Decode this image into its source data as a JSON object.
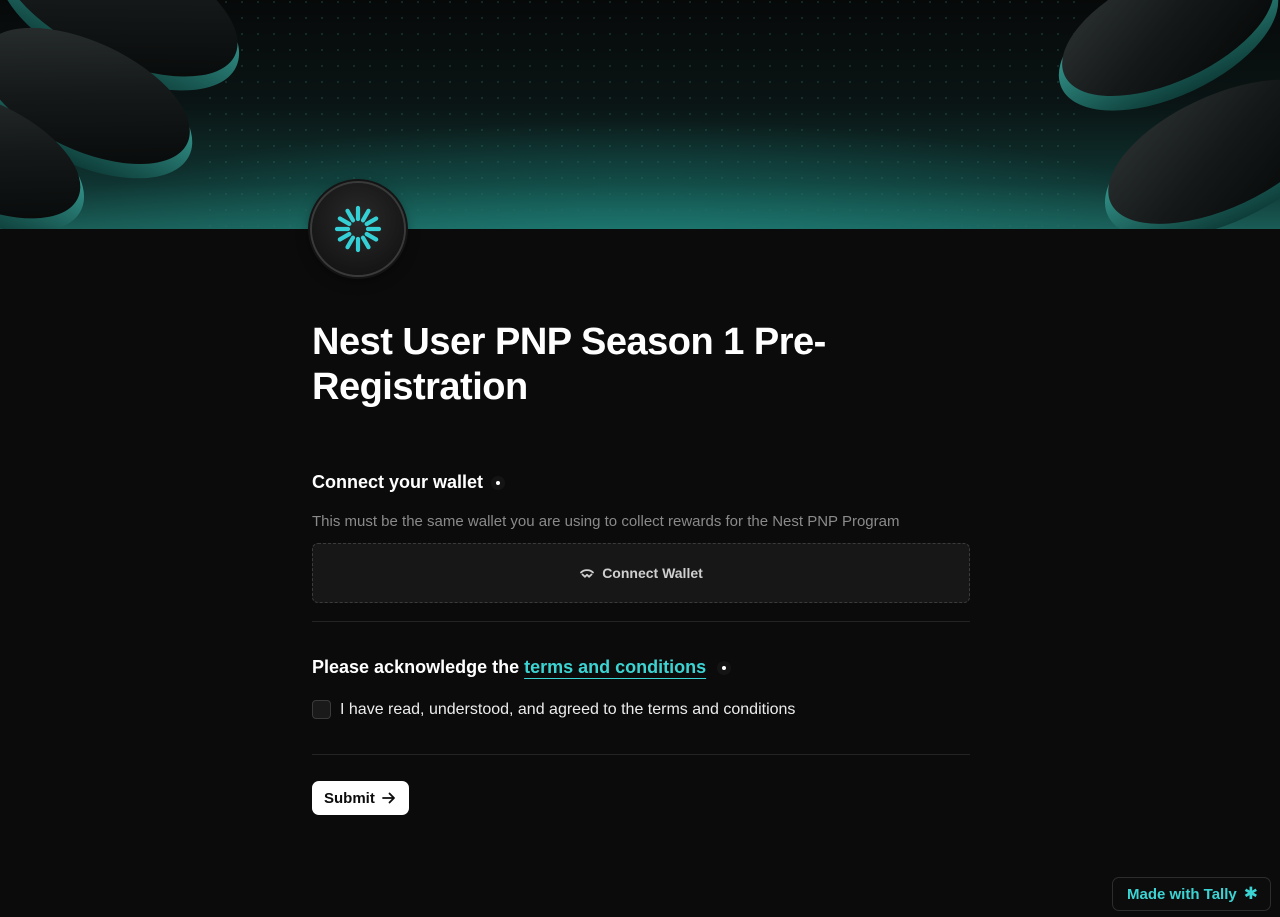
{
  "colors": {
    "background": "#0b0b0b",
    "accent": "#3cd3d3",
    "text": "#ffffff",
    "muted": "#8a8a8a"
  },
  "form": {
    "title": "Nest User PNP Season 1 Pre-Registration",
    "wallet_question": {
      "label": "Connect your wallet",
      "required": true,
      "help_text": "This must be the same wallet you are using to collect rewards for the Nest PNP Program",
      "button_label": "Connect Wallet",
      "button_icon": "walletconnect-icon"
    },
    "terms_question": {
      "label_prefix": "Please acknowledge the",
      "link_text": "terms and conditions",
      "required": true,
      "checkbox_label": "I have read, understood, and agreed to the terms and conditions",
      "checked": false
    },
    "submit_label": "Submit",
    "submit_icon": "arrow-right-icon"
  },
  "badge": {
    "label": "Made with Tally",
    "icon": "asterisk-icon"
  }
}
